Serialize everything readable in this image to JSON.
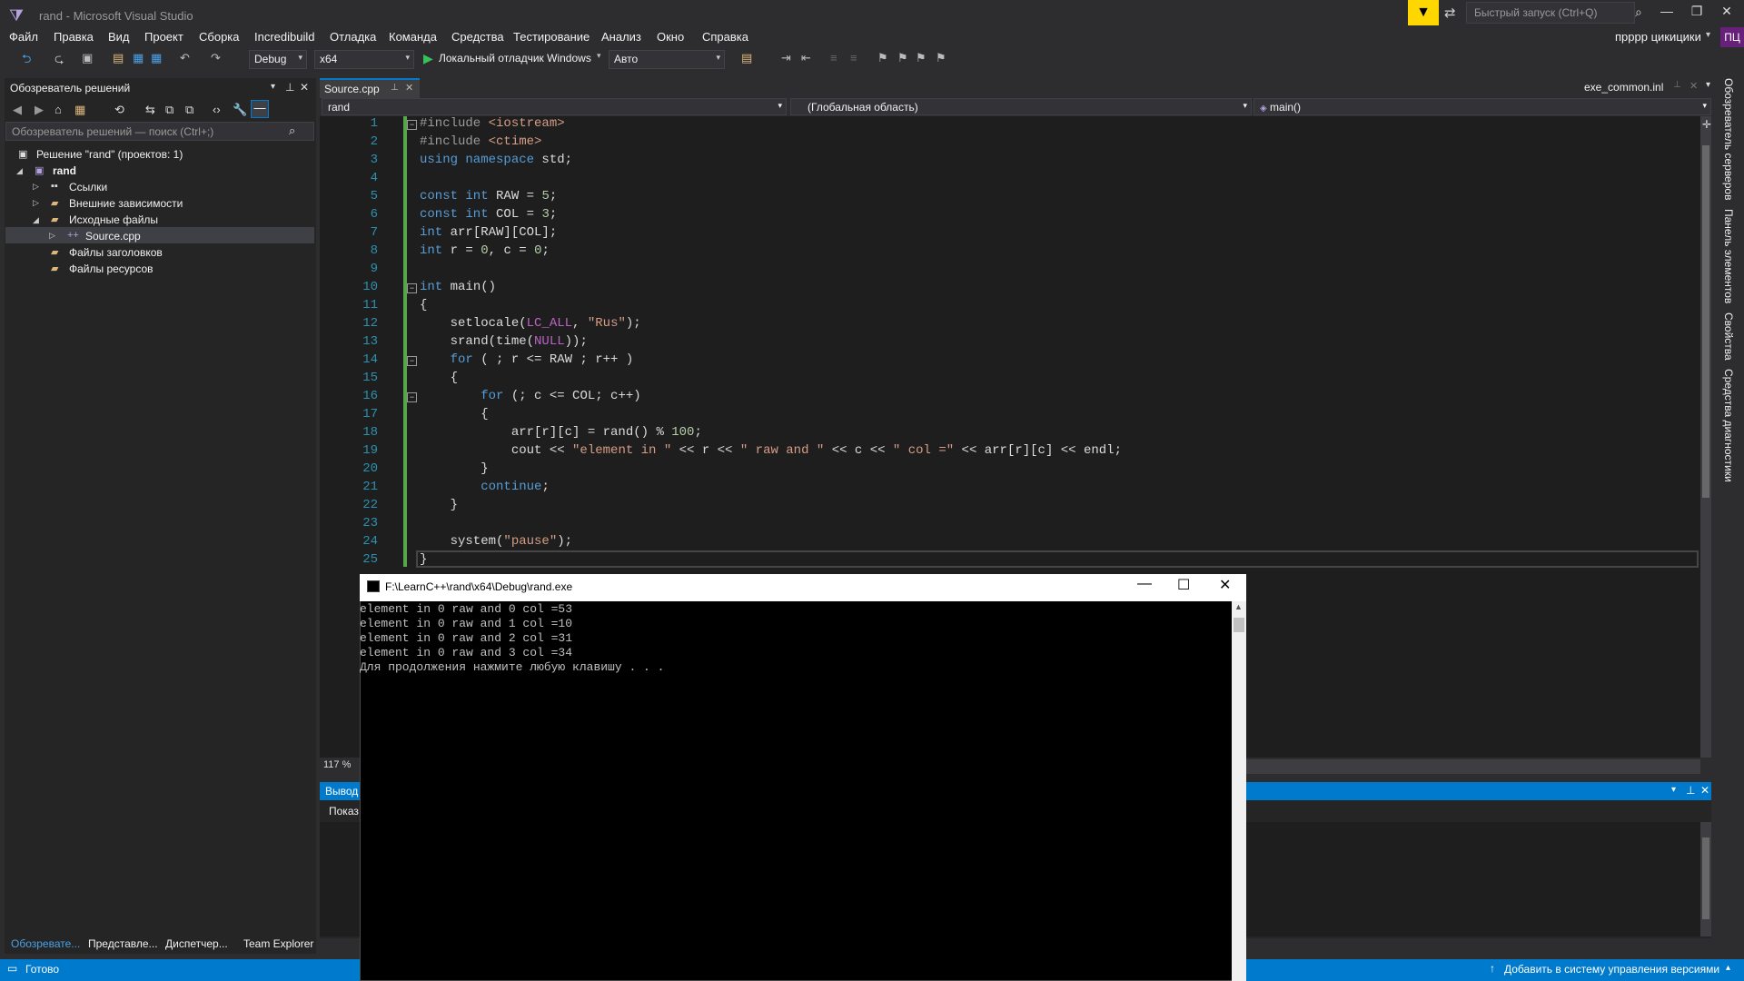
{
  "window": {
    "title": "rand - Microsoft Visual Studio",
    "quick_launch": "Быстрый запуск (Ctrl+Q)",
    "user": "прррр цикицики",
    "user_badge": "ПЦ"
  },
  "menu": [
    "Файл",
    "Правка",
    "Вид",
    "Проект",
    "Сборка",
    "Incredibuild",
    "Отладка",
    "Команда",
    "Средства",
    "Тестирование",
    "Анализ",
    "Окно",
    "Справка"
  ],
  "toolbar": {
    "config": "Debug",
    "platform": "x64",
    "debugger": "Локальный отладчик Windows",
    "mode": "Авто"
  },
  "solution_explorer": {
    "title": "Обозреватель решений",
    "search": "Обозреватель решений — поиск (Ctrl+;)",
    "tree": [
      "Решение \"rand\" (проектов: 1)",
      "rand",
      "Ссылки",
      "Внешние зависимости",
      "Исходные файлы",
      "Source.cpp",
      "Файлы заголовков",
      "Файлы ресурсов"
    ],
    "bottom_tabs": [
      "Обозревате...",
      "Представле...",
      "Диспетчер...",
      "Team Explorer"
    ]
  },
  "editor": {
    "tab": "Source.cpp",
    "right_tab": "exe_common.inl",
    "nav_project": "rand",
    "nav_scope": "(Глобальная область)",
    "nav_member": "main()",
    "zoom": "117 %"
  },
  "code_lines": [
    "1",
    "2",
    "3",
    "4",
    "5",
    "6",
    "7",
    "8",
    "9",
    "10",
    "11",
    "12",
    "13",
    "14",
    "15",
    "16",
    "17",
    "18",
    "19",
    "20",
    "21",
    "22",
    "23",
    "24",
    "25"
  ],
  "output": {
    "title": "Вывод",
    "show": "Показ"
  },
  "right_rail": [
    "Обозреватель серверов",
    "Панель элементов",
    "Свойства",
    "Средства диагностики"
  ],
  "status": {
    "text": "Готово",
    "vcs": "Добавить в систему управления версиями"
  },
  "console": {
    "title": "F:\\LearnC++\\rand\\x64\\Debug\\rand.exe",
    "lines": [
      "element in 0 raw and 0 col =53",
      "element in 0 raw and 1 col =10",
      "element in 0 raw and 2 col =31",
      "element in 0 raw and 3 col =34",
      "Для продолжения нажмите любую клавишу . . ."
    ]
  }
}
